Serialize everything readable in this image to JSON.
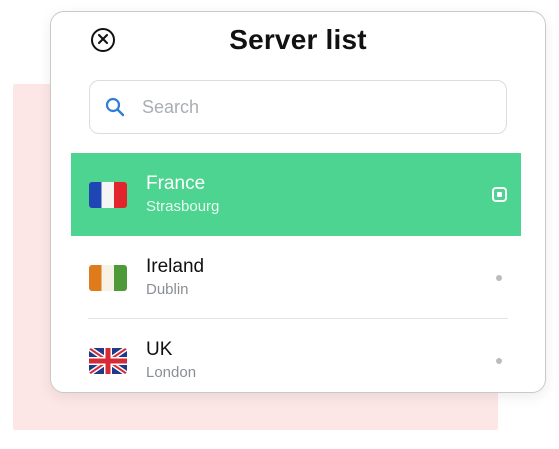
{
  "header": {
    "title": "Server list"
  },
  "search": {
    "placeholder": "Search",
    "value": ""
  },
  "icons": {
    "close": "close-icon",
    "search": "search-icon"
  },
  "colors": {
    "selected_row": "#4cd490",
    "backdrop": "#fde6e6",
    "search_icon": "#2f7ed8"
  },
  "servers": [
    {
      "country": "France",
      "city": "Strasbourg",
      "flag": "france-flag-icon",
      "selected": true
    },
    {
      "country": "Ireland",
      "city": "Dublin",
      "flag": "ireland-flag-icon",
      "selected": false
    },
    {
      "country": "UK",
      "city": "London",
      "flag": "uk-flag-icon",
      "selected": false
    }
  ]
}
